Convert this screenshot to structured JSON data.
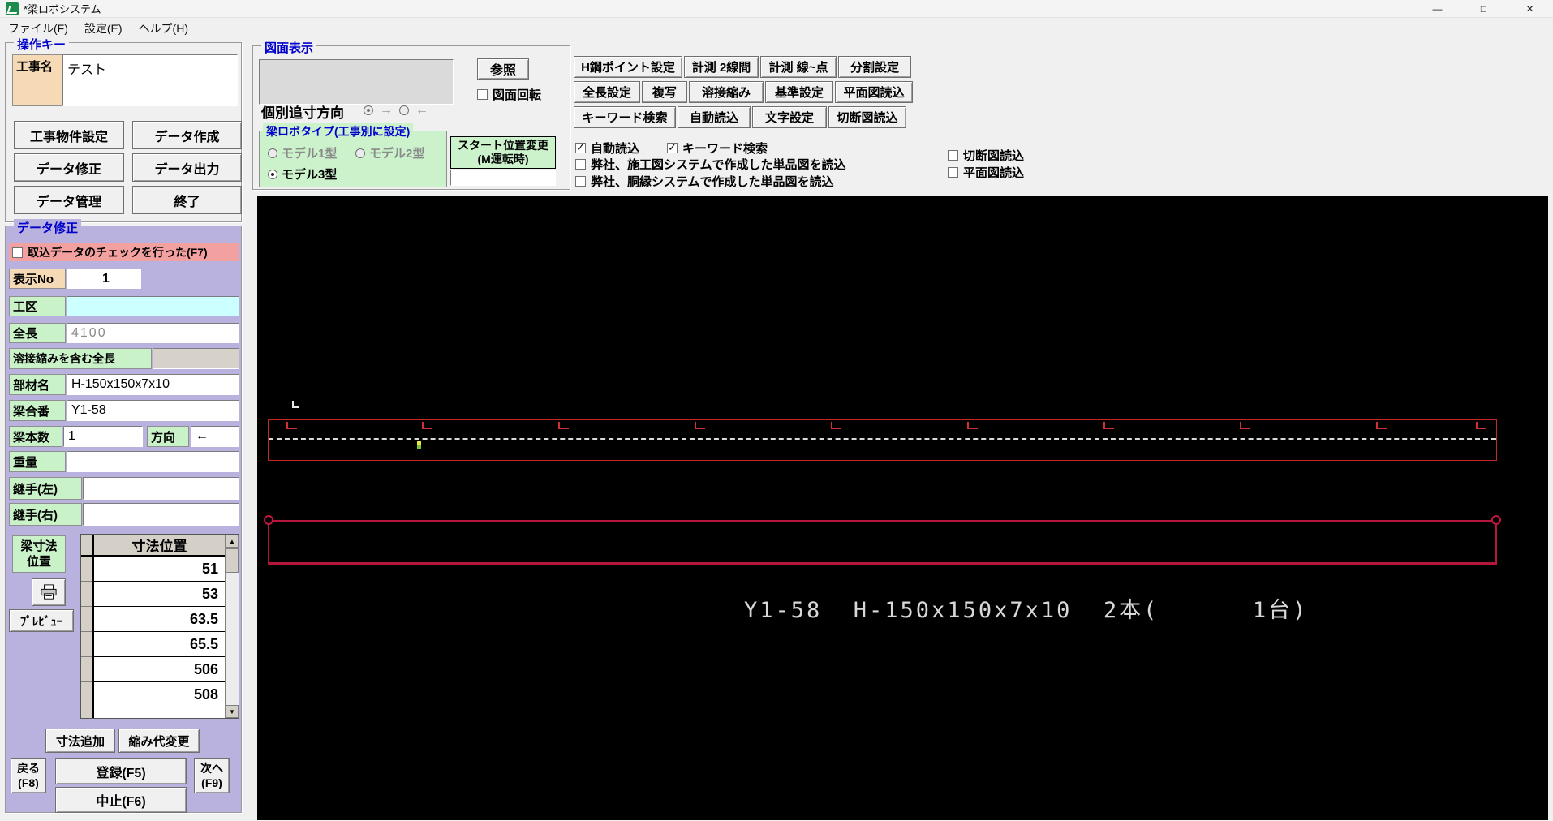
{
  "window": {
    "title": "*梁ロボシステム",
    "menu": {
      "file": "ファイル(F)",
      "settings": "設定(E)",
      "help": "ヘルプ(H)"
    },
    "minimize": "—",
    "maximize": "□",
    "close": "✕"
  },
  "op": {
    "group": "操作キー",
    "kojimei": {
      "label": "工事名",
      "value": "テスト"
    },
    "buttons": [
      "工事物件設定",
      "データ作成",
      "データ修正",
      "データ出力",
      "データ管理",
      "終了"
    ]
  },
  "edit": {
    "group": "データ修正",
    "check_f7": {
      "label": "取込データのチェックを行った(F7)",
      "checked": false
    },
    "hyoji_no": {
      "label": "表示No",
      "value": "1"
    },
    "koku": {
      "label": "工区",
      "value": ""
    },
    "zencho": {
      "label": "全長",
      "value": "4100"
    },
    "yosetsu": {
      "label": "溶接縮みを含む全長",
      "value": ""
    },
    "buzai": {
      "label": "部材名",
      "value": "H-150x150x7x10"
    },
    "goban": {
      "label": "梁合番",
      "value": "Y1-58"
    },
    "honsu": {
      "label": "梁本数",
      "value": "1"
    },
    "hoko": {
      "label": "方向",
      "value": "←"
    },
    "juryo": {
      "label": "重量",
      "value": ""
    },
    "tsugite_l": {
      "label": "継手(左)",
      "value": ""
    },
    "tsugite_r": {
      "label": "継手(右)",
      "value": ""
    },
    "sunpo_label": [
      "梁寸法",
      "位置"
    ],
    "preview_btn": "ﾌﾟﾚﾋﾞｭｰ",
    "list": {
      "header": "寸法位置",
      "values": [
        "51",
        "53",
        "63.5",
        "65.5",
        "506",
        "508"
      ]
    },
    "add_btn": "寸法追加",
    "shrink_btn": "縮み代変更",
    "back_btn": [
      "戻る",
      "(F8)"
    ],
    "register_btn": "登録(F5)",
    "next_btn": [
      "次へ",
      "(F9)"
    ],
    "cancel_btn": "中止(F6)"
  },
  "draw": {
    "group": "図面表示",
    "ref_btn": "参照",
    "rotate": {
      "label": "図面回転",
      "checked": false
    },
    "tsuisun": {
      "label": "個別追寸方向",
      "radios": [
        {
          "mark": "→",
          "on": true
        },
        {
          "mark": "←",
          "on": false
        }
      ]
    },
    "type": {
      "group": "梁ロボタイプ(工事別に設定)",
      "options": [
        {
          "label": "モデル1型",
          "on": false,
          "disabled": true
        },
        {
          "label": "モデル2型",
          "on": false,
          "disabled": true
        },
        {
          "label": "モデル3型",
          "on": true,
          "disabled": false
        }
      ]
    },
    "start": {
      "line1": "スタート位置変更",
      "line2": "(M運転時)",
      "value": ""
    },
    "toolbar": [
      [
        "H鋼ポイント設定",
        "計測 2線間",
        "計測 線~点",
        "分割設定"
      ],
      [
        "全長設定",
        "複写",
        "溶接縮み",
        "基準設定",
        "平面図読込"
      ],
      [
        "キーワード検索",
        "自動読込",
        "文字設定",
        "切断図読込"
      ]
    ],
    "checks": [
      {
        "label": "自動読込",
        "checked": true
      },
      {
        "label": "キーワード検索",
        "checked": true
      },
      {
        "label": "弊社、施工図システムで作成した単品図を読込",
        "checked": false
      },
      {
        "label": "弊社、胴縁システムで作成した単品図を読込",
        "checked": false
      }
    ],
    "right_checks": [
      {
        "label": "切断図読込",
        "checked": false
      },
      {
        "label": "平面図読込",
        "checked": false
      }
    ]
  },
  "canvas": {
    "annotation": "Y1-58  H-150x150x7x10  2本(      1台)",
    "beam_label": "Y1-58",
    "beam_section": "H-150x150x7x10",
    "beam_count": "2本(",
    "unit_count": "1台)",
    "colors": {
      "beam1": "#c62828",
      "beam2": "#b4163c",
      "dash": "#d8d8d8",
      "text": "#d8d8d8",
      "background": "#000000"
    }
  }
}
